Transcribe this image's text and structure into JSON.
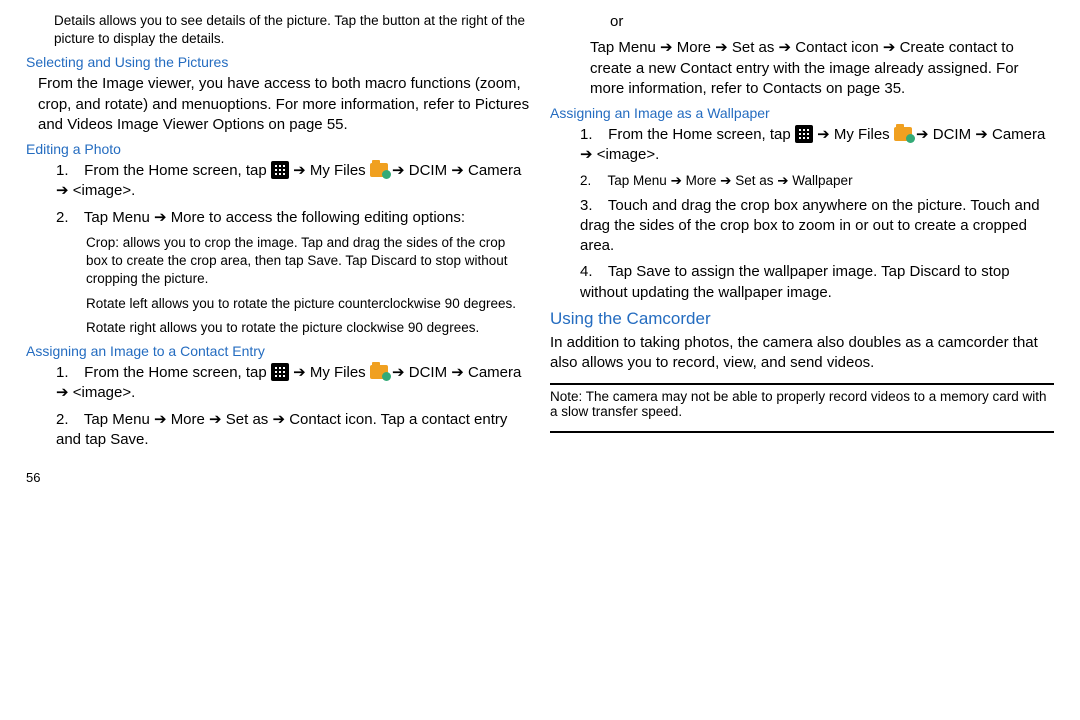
{
  "left": {
    "details_line": "Details allows you to see details of the picture. Tap the button at the right of the picture to display the details.",
    "h_select": "Selecting and Using the Pictures",
    "select_para_1": "From the Image viewer, you have access to both macro functions (zoom, crop, and rotate) and ",
    "select_para_2": "options",
    "select_para_3": "menu",
    "select_para_4": ". For more information, refer to ",
    "select_para_5": "Pictures and Videos Image Viewer Options",
    "select_para_6": " on page 55.",
    "h_edit": "Editing a Photo",
    "edit_1a": "From the Home screen, ",
    "edit_1b": "tap",
    "edit_1c": " ➔ My Files ",
    "edit_1d": " ➔ DCIM ➔ Camera ➔ <image>.",
    "edit_2a": "Tap ",
    "edit_2b": "Menu ➔ More ",
    "edit_2c": "to access the following editing options:",
    "crop": "Crop: allows you to crop the image. Tap and drag the sides of the crop box to create the crop area, then tap Save. Tap Discard to stop without cropping the picture.",
    "rotl": "Rotate left allows you to rotate the picture counterclockwise 90 degrees.",
    "rotr": "Rotate right allows you to rotate the picture clockwise 90 degrees.",
    "h_assign_contact": "Assigning an Image to a Contact Entry",
    "ac_1a": "From the Home screen, ",
    "ac_1b": "tap",
    "ac_1c": " ➔ My Files ",
    "ac_1d": " ➔ DCIM ➔ Camera ➔ <image>.",
    "ac_2a": "Tap ",
    "ac_2b": "Menu ➔ More ➔ Set as ➔ Contact icon",
    "ac_2c": ". Tap a contact entry and tap Save.",
    "page_num": "56"
  },
  "right": {
    "or": "or",
    "or_line_a": "Tap ",
    "or_line_b": "Menu ➔ More ➔ Set as ➔ Contact icon ➔ Create contact",
    "or_line_c": " to create a new Contact entry with the image already assigned. For more in",
    "or_line_d": "formation, refer to ",
    "or_line_e": "Contacts",
    "or_line_f": " on page 35.",
    "h_assign_wall": "Assigning an Image as a Wallpaper",
    "aw_1a": "From the Home screen, ",
    "aw_1b": "tap",
    "aw_1c": " ➔ My Files ",
    "aw_1d": " ➔ DCIM ➔ Camera ➔ <image>.",
    "aw_2a": "Tap ",
    "aw_2b": "Menu ➔ More ➔ Set as ➔ Wallpaper",
    "aw_3": "Touch and drag the crop box anywhere on the picture. Touch and drag the sides of the crop box to zoom in or out to create a cropped area.",
    "aw_4a": "Tap ",
    "aw_4b": "Save ",
    "aw_4c": "to assign the wallpaper image. Tap ",
    "aw_4d": "Discard ",
    "aw_4e": "to stop without updating the wallpaper image.",
    "h_cam": "Using the Camcorder",
    "cam_para": "In addition to taking photos, the camera also doubles as a camcorder that also allows you to record, view, and send videos.",
    "note_label": "Note:",
    "note_text": " The camera may not be able to properly record videos to a memory card with a slow transfer speed."
  }
}
